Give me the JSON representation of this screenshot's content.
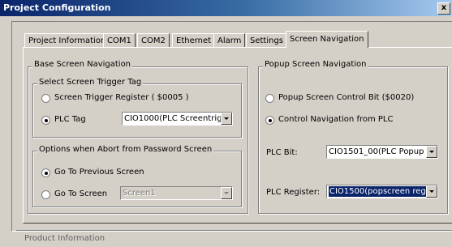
{
  "window": {
    "title": "Project Configuration",
    "close_glyph": "x"
  },
  "tabs": [
    {
      "label": "Project Information"
    },
    {
      "label": "COM1"
    },
    {
      "label": "COM2"
    },
    {
      "label": "Ethernet"
    },
    {
      "label": "Alarm"
    },
    {
      "label": "Settings"
    },
    {
      "label": "Screen Navigation",
      "active": true
    }
  ],
  "base_nav": {
    "title": "Base Screen Navigation",
    "trigger": {
      "title": "Select Screen Trigger Tag",
      "register_label": "Screen Trigger Register ( $0005 )",
      "plc_tag_label": "PLC Tag",
      "plc_tag_value": "CIO1000(PLC Screentrig",
      "selected": "plc_tag"
    },
    "abort": {
      "title": "Options when Abort from Password Screen",
      "previous_label": "Go To Previous Screen",
      "goto_label": "Go To Screen",
      "goto_value": "Screen1",
      "goto_disabled": true,
      "selected": "previous"
    }
  },
  "popup_nav": {
    "title": "Popup Screen Navigation",
    "control_bit_label": "Popup Screen Control Bit ($0020)",
    "from_plc_label": "Control Navigation from PLC",
    "selected": "from_plc",
    "plc_bit_label": "PLC Bit:",
    "plc_bit_value": "CIO1501_00(PLC Popup",
    "plc_register_label": "PLC Register:",
    "plc_register_value": "CIO1500(popscreen reg"
  },
  "product_info": {
    "title": "Product Information"
  },
  "colors": {
    "face": "#d4d0c8",
    "titlebar_start": "#0a246a",
    "titlebar_end": "#a6caf0",
    "selection": "#0a246a"
  }
}
